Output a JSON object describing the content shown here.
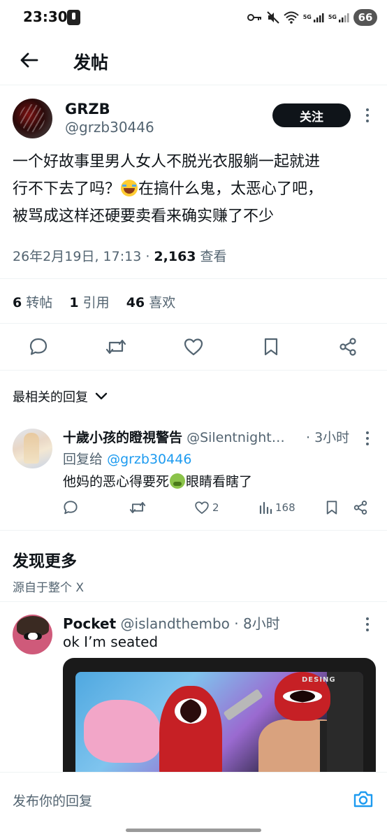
{
  "status_bar": {
    "time": "23:30",
    "network_labels": [
      "5G",
      "5G"
    ],
    "battery": "66"
  },
  "header": {
    "title": "发帖"
  },
  "post": {
    "author_name": "GRZB",
    "author_handle": "@grzb30446",
    "follow_label": "关注",
    "text_line1": "一个好故事里男人女人不脱光衣服躺一起就进",
    "text_line2_a": "行不下去了吗？",
    "text_line2_b": "在搞什么鬼，太恶心了吧，",
    "text_line3": "被骂成这样还硬要卖看来确实赚了不少",
    "emoji": "face-with-tears-of-joy",
    "timestamp": "26年2月19日, 17:13 · ",
    "views_count": "2,163",
    "views_label": " 查看",
    "retweets_count": "6",
    "retweets_label": "转帖",
    "quotes_count": "1",
    "quotes_label": "引用",
    "likes_count": "46",
    "likes_label": "喜欢"
  },
  "replies_sort": {
    "label": "最相关的回复"
  },
  "reply": {
    "name": "十歲小孩的瞪視警告",
    "handle": "@Silentnight…",
    "time": "· 3小时",
    "reply_to_label": "回复给",
    "reply_to_handle": "@grzb30446",
    "text_a": "他妈的恶心得要死",
    "text_b": "眼睛看瞎了",
    "emoji": "nauseated-face",
    "likes": "2",
    "views": "168"
  },
  "discover": {
    "title": "发现更多",
    "subtitle": "源自于整个 X"
  },
  "suggested_post": {
    "name": "Pocket",
    "handle": "@islandthembo",
    "time": "· 8小时",
    "text": "ok I’m seated",
    "media_brand": "DESING"
  },
  "composer": {
    "placeholder": "发布你的回复"
  },
  "colors": {
    "accent": "#1d9bf0",
    "text_primary": "#0f1419",
    "text_secondary": "#536471",
    "divider": "#eff3f4"
  }
}
